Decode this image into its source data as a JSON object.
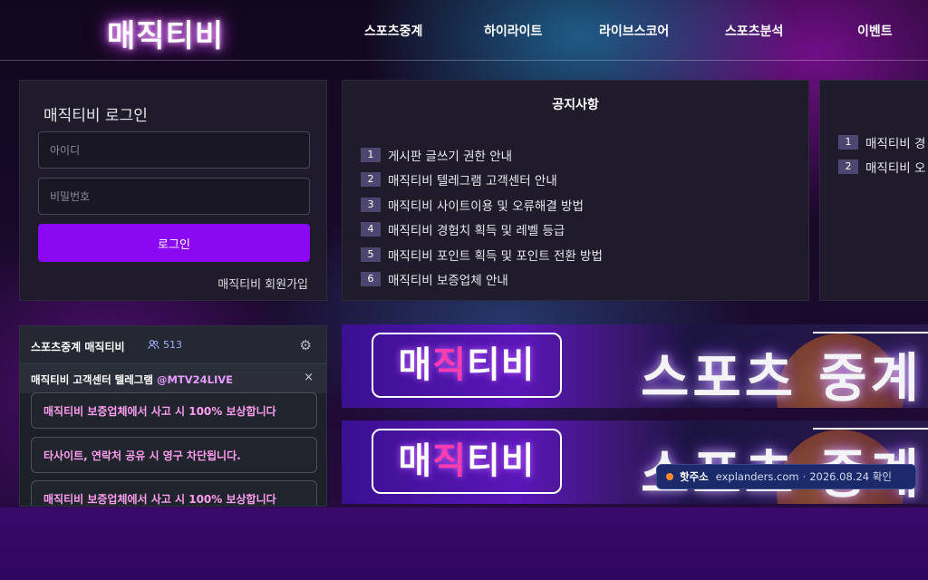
{
  "header": {
    "logo": "매직티비",
    "nav": [
      "스포츠중계",
      "하이라이트",
      "라이브스코어",
      "스포츠분석",
      "이벤트"
    ]
  },
  "login": {
    "title": "매직티비 로그인",
    "id_placeholder": "아이디",
    "pw_placeholder": "비밀번호",
    "button": "로그인",
    "join": "매직티비 회원가입"
  },
  "notice": {
    "title": "공지사항",
    "items": [
      {
        "num": "1",
        "text": "게시판 글쓰기 권한 안내"
      },
      {
        "num": "2",
        "text": "매직티비 텔레그램 고객센터 안내"
      },
      {
        "num": "3",
        "text": "매직티비 사이트이용 및 오류해결 방법"
      },
      {
        "num": "4",
        "text": "매직티비 경험치 획득 및 레벨 등급"
      },
      {
        "num": "5",
        "text": "매직티비 포인트 획득 및 포인트 전환 방법"
      },
      {
        "num": "6",
        "text": "매직티비 보증업체 안내"
      }
    ]
  },
  "side_notice": {
    "items": [
      {
        "num": "1",
        "text": "매직티비 경"
      },
      {
        "num": "2",
        "text": "매직티비 오"
      }
    ]
  },
  "chat": {
    "title": "스포츠중계 매직티비",
    "user_count": "513",
    "notice_text": "매직티비 고객센터 텔레그램 ",
    "notice_handle": "@MTV24LIVE",
    "messages": [
      "매직티비 보증업체에서 사고 시 100% 보상합니다",
      "타사이트, 연락처 공유 시 영구 차단됩니다.",
      "매직티비 보증업체에서 사고 시 100% 보상합니다"
    ]
  },
  "banners": [
    {
      "logo_a": "매",
      "logo_b": "직",
      "logo_c": "티비",
      "text": "스포츠 중계"
    },
    {
      "logo_a": "매",
      "logo_b": "직",
      "logo_c": "티비",
      "text": "스포츠 중계"
    }
  ],
  "toast": {
    "label": "핫주소",
    "url": "explanders.com",
    "sep": "·",
    "date": "2026.08.24 확인"
  },
  "colors": {
    "accent_button": "#8a08f2",
    "logo_glow": "#e060ff",
    "chat_highlight": "#ff9df0",
    "toast_bg": "#1a2a6a",
    "toast_dot": "#ff8a2a"
  },
  "icons": {
    "users": "users-icon",
    "settings": "gear-icon",
    "close": "close-icon",
    "status_dot": "dot-icon"
  }
}
